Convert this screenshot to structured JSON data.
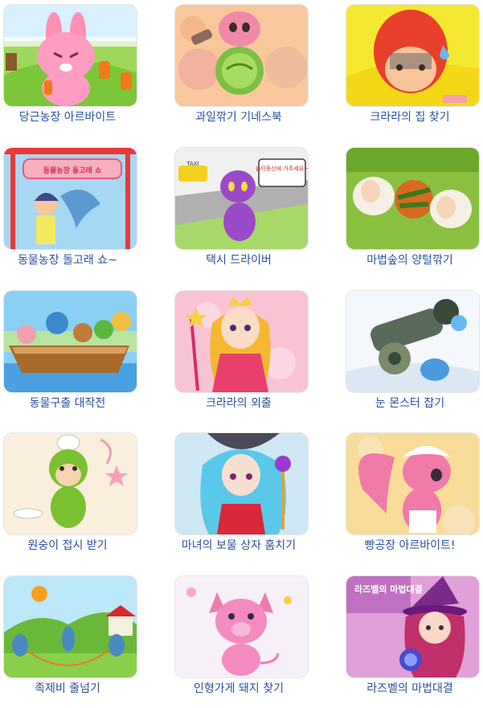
{
  "games": [
    {
      "title": "당근농장 아르바이트",
      "thumb_icon": "pink-rabbit-carrot-icon"
    },
    {
      "title": "과일깎기 기네스북",
      "thumb_icon": "squirrel-cabbage-icon"
    },
    {
      "title": "크라라의 집 찾기",
      "thumb_icon": "red-hood-girl-icon"
    },
    {
      "title": "동물농장 돌고래 쇼~",
      "thumb_icon": "dolphin-show-icon",
      "sign_text": "동물농장 돌고래 쇼"
    },
    {
      "title": "택시 드라이버",
      "thumb_icon": "purple-cat-taxi-icon",
      "sign_text": "놀이동산에 가주세요~",
      "taxi_text": "TAXI"
    },
    {
      "title": "마법숲의 양털깎기",
      "thumb_icon": "sheep-shearing-icon"
    },
    {
      "title": "동물구출 대작전",
      "thumb_icon": "animal-boat-icon"
    },
    {
      "title": "크라라의 외출",
      "thumb_icon": "princess-girl-icon"
    },
    {
      "title": "눈 몬스터 잡기",
      "thumb_icon": "snow-cannon-icon"
    },
    {
      "title": "원숭이 접시 받기",
      "thumb_icon": "green-monkey-icon"
    },
    {
      "title": "마녀의 보물 상자 훔치기",
      "thumb_icon": "blue-witch-icon"
    },
    {
      "title": "빵공장 아르바이트!",
      "thumb_icon": "pink-squirrel-baker-icon"
    },
    {
      "title": "족제비 줄넘기",
      "thumb_icon": "weasel-jumprope-icon"
    },
    {
      "title": "인형가게 돼지 찾기",
      "thumb_icon": "pink-pig-doll-icon"
    },
    {
      "title": "라즈벨의 마법대결",
      "thumb_icon": "raspberry-witch-icon",
      "logo_text": "라즈벨의 마법대결"
    }
  ]
}
